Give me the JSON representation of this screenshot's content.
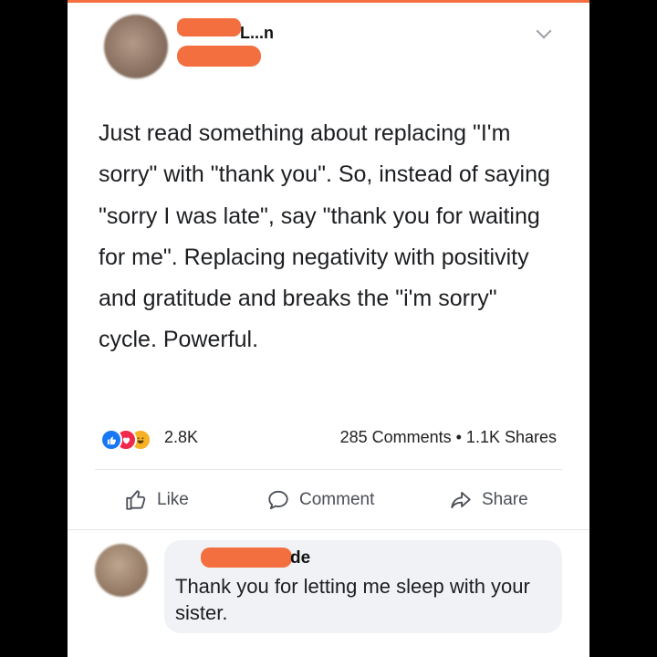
{
  "post": {
    "author_name_fragment": "L...n",
    "text": "Just read something about replacing \"I'm sorry\" with \"thank you\". So, instead of saying \"sorry I was late\", say \"thank you for waiting for me\". Replacing negativity with positivity and gratitude and breaks the \"i'm sorry\" cycle. Powerful.",
    "reaction_count": "2.8K",
    "reaction_icons": [
      "like-icon",
      "love-icon",
      "haha-icon"
    ],
    "stats": "285 Comments • 1.1K Shares"
  },
  "actions": {
    "like": "Like",
    "comment": "Comment",
    "share": "Share"
  },
  "comment": {
    "author_name_fragment": "de",
    "text": "Thank you for letting me sleep with your sister."
  },
  "colors": {
    "redaction": "#f36f3f",
    "like_blue": "#1877f2",
    "love_red": "#f0284a",
    "haha_yellow": "#f7b125"
  }
}
